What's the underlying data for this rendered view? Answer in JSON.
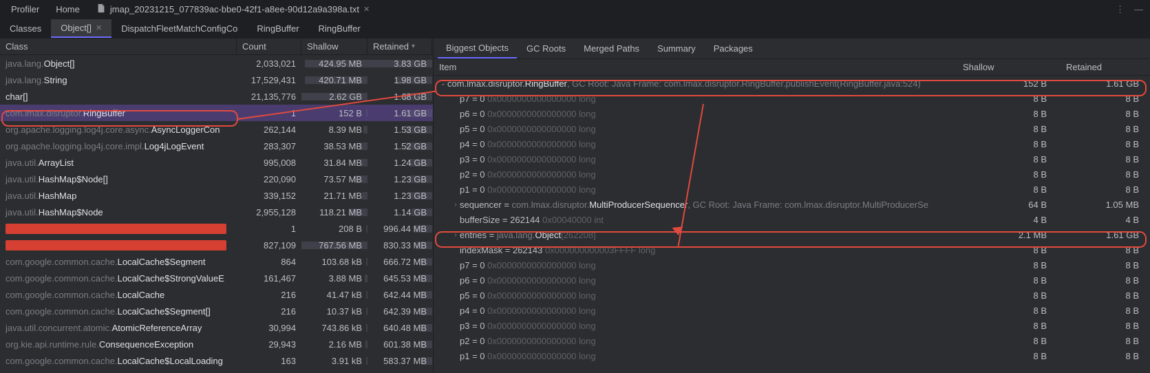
{
  "topTabs": {
    "profiler": "Profiler",
    "home": "Home",
    "filename": "jmap_20231215_077839ac-bbe0-42f1-a8ee-90d12a9a398a.txt"
  },
  "winControls": {
    "more": "⋮",
    "min": "—"
  },
  "subTabs": [
    {
      "label": "Classes",
      "close": false
    },
    {
      "label": "Object[]",
      "close": true,
      "active": true
    },
    {
      "label": "DispatchFleetMatchConfigCo",
      "close": false
    },
    {
      "label": "RingBuffer",
      "close": false
    },
    {
      "label": "RingBuffer",
      "close": false
    }
  ],
  "columns": {
    "class": "Class",
    "count": "Count",
    "shallow": "Shallow",
    "retained": "Retained"
  },
  "classRows": [
    {
      "pkg": "java.lang.",
      "cls": "Object[]",
      "count": "2,033,021",
      "shallow": "424.95 MB",
      "retained": "3.83 GB",
      "sb": 95,
      "rb": 100
    },
    {
      "pkg": "java.lang.",
      "cls": "String",
      "count": "17,529,431",
      "shallow": "420.71 MB",
      "retained": "1.98 GB",
      "sb": 95,
      "rb": 55
    },
    {
      "pkg": "",
      "cls": "char[]",
      "count": "21,135,776",
      "shallow": "2.62 GB",
      "retained": "1.68 GB",
      "sb": 100,
      "rb": 46
    },
    {
      "pkg": "com.lmax.disruptor.",
      "cls": "RingBuffer",
      "count": "1",
      "shallow": "152 B",
      "retained": "1.61 GB",
      "sb": 2,
      "rb": 44,
      "selected": true
    },
    {
      "pkg": "org.apache.logging.log4j.core.async.",
      "cls": "AsyncLoggerCon",
      "count": "262,144",
      "shallow": "8.39 MB",
      "retained": "1.53 GB",
      "sb": 6,
      "rb": 42
    },
    {
      "pkg": "org.apache.logging.log4j.core.impl.",
      "cls": "Log4jLogEvent",
      "count": "283,307",
      "shallow": "38.53 MB",
      "retained": "1.52 GB",
      "sb": 12,
      "rb": 42
    },
    {
      "pkg": "java.util.",
      "cls": "ArrayList",
      "count": "995,008",
      "shallow": "31.84 MB",
      "retained": "1.24 GB",
      "sb": 10,
      "rb": 35
    },
    {
      "pkg": "java.util.",
      "cls": "HashMap$Node[]",
      "count": "220,090",
      "shallow": "73.57 MB",
      "retained": "1.23 GB",
      "sb": 20,
      "rb": 35
    },
    {
      "pkg": "java.util.",
      "cls": "HashMap",
      "count": "339,152",
      "shallow": "21.71 MB",
      "retained": "1.23 GB",
      "sb": 8,
      "rb": 35
    },
    {
      "pkg": "java.util.",
      "cls": "HashMap$Node",
      "count": "2,955,128",
      "shallow": "118.21 MB",
      "retained": "1.14 GB",
      "sb": 28,
      "rb": 32
    },
    {
      "redacted": true,
      "count": "1",
      "shallow": "208 B",
      "retained": "996.44 MB",
      "sb": 2,
      "rb": 28,
      "rw": 98
    },
    {
      "redacted": true,
      "count": "827,109",
      "shallow": "767.56 MB",
      "retained": "830.33 MB",
      "sb": 100,
      "rb": 24,
      "rw": 98
    },
    {
      "pkg": "com.google.common.cache.",
      "cls": "LocalCache$Segment",
      "count": "864",
      "shallow": "103.68 kB",
      "retained": "666.72 MB",
      "sb": 2,
      "rb": 20
    },
    {
      "pkg": "com.google.common.cache.",
      "cls": "LocalCache$StrongValueE",
      "count": "161,467",
      "shallow": "3.88 MB",
      "retained": "645.53 MB",
      "sb": 4,
      "rb": 19
    },
    {
      "pkg": "com.google.common.cache.",
      "cls": "LocalCache",
      "count": "216",
      "shallow": "41.47 kB",
      "retained": "642.44 MB",
      "sb": 2,
      "rb": 19
    },
    {
      "pkg": "com.google.common.cache.",
      "cls": "LocalCache$Segment[]",
      "count": "216",
      "shallow": "10.37 kB",
      "retained": "642.39 MB",
      "sb": 2,
      "rb": 19
    },
    {
      "pkg": "java.util.concurrent.atomic.",
      "cls": "AtomicReferenceArray",
      "count": "30,994",
      "shallow": "743.86 kB",
      "retained": "640.48 MB",
      "sb": 2,
      "rb": 19
    },
    {
      "pkg": "org.kie.api.runtime.rule.",
      "cls": "ConsequenceException",
      "count": "29,943",
      "shallow": "2.16 MB",
      "retained": "601.38 MB",
      "sb": 3,
      "rb": 18
    },
    {
      "pkg": "com.google.common.cache.",
      "cls": "LocalCache$LocalLoading",
      "count": "163",
      "shallow": "3.91 kB",
      "retained": "583.37 MB",
      "sb": 2,
      "rb": 17
    }
  ],
  "rightTabs": [
    "Biggest Objects",
    "GC Roots",
    "Merged Paths",
    "Summary",
    "Packages"
  ],
  "rightTabActive": 0,
  "treeColumns": {
    "item": "Item",
    "shallow": "Shallow",
    "retained": "Retained"
  },
  "treeRows": [
    {
      "lvl": 0,
      "chev": "v",
      "pre": "com.lmax.disruptor.",
      "name": "RingBuffer",
      "suf": ", GC Root: Java Frame: com.lmax.disruptor.RingBuffer.publishEvent(RingBuffer.java:524)",
      "sh": "152 B",
      "rt": "1.61 GB"
    },
    {
      "lvl": 1,
      "pre": "p7 = 0 ",
      "hex": "0x0000000000000000  long",
      "sh": "8 B",
      "rt": "8 B"
    },
    {
      "lvl": 1,
      "pre": "p6 = 0 ",
      "hex": "0x0000000000000000  long",
      "sh": "8 B",
      "rt": "8 B"
    },
    {
      "lvl": 1,
      "pre": "p5 = 0 ",
      "hex": "0x0000000000000000  long",
      "sh": "8 B",
      "rt": "8 B"
    },
    {
      "lvl": 1,
      "pre": "p4 = 0 ",
      "hex": "0x0000000000000000  long",
      "sh": "8 B",
      "rt": "8 B"
    },
    {
      "lvl": 1,
      "pre": "p3 = 0 ",
      "hex": "0x0000000000000000  long",
      "sh": "8 B",
      "rt": "8 B"
    },
    {
      "lvl": 1,
      "pre": "p2 = 0 ",
      "hex": "0x0000000000000000  long",
      "sh": "8 B",
      "rt": "8 B"
    },
    {
      "lvl": 1,
      "pre": "p1 = 0 ",
      "hex": "0x0000000000000000  long",
      "sh": "8 B",
      "rt": "8 B"
    },
    {
      "lvl": 1,
      "chev": ">",
      "pre": "sequencer = ",
      "mid": "com.lmax.disruptor.",
      "name": "MultiProducerSequencer",
      "suf": ", GC Root: Java Frame: com.lmax.disruptor.MultiProducerSe",
      "sh": "64 B",
      "rt": "1.05 MB"
    },
    {
      "lvl": 1,
      "pre": "bufferSize = 262144 ",
      "hex": "0x00040000  int",
      "sh": "4 B",
      "rt": "4 B"
    },
    {
      "lvl": 1,
      "chev": ">",
      "pre": "entries = ",
      "mid": "java.lang.",
      "name": "Object",
      "idx": "[262208]",
      "sh": "2.1 MB",
      "rt": "1.61 GB",
      "selected": true
    },
    {
      "lvl": 1,
      "pre": "indexMask = 262143 ",
      "hex": "0x000000000003FFFF  long",
      "sh": "8 B",
      "rt": "8 B"
    },
    {
      "lvl": 1,
      "pre": "p7 = 0 ",
      "hex": "0x0000000000000000  long",
      "sh": "8 B",
      "rt": "8 B"
    },
    {
      "lvl": 1,
      "pre": "p6 = 0 ",
      "hex": "0x0000000000000000  long",
      "sh": "8 B",
      "rt": "8 B"
    },
    {
      "lvl": 1,
      "pre": "p5 = 0 ",
      "hex": "0x0000000000000000  long",
      "sh": "8 B",
      "rt": "8 B"
    },
    {
      "lvl": 1,
      "pre": "p4 = 0 ",
      "hex": "0x0000000000000000  long",
      "sh": "8 B",
      "rt": "8 B"
    },
    {
      "lvl": 1,
      "pre": "p3 = 0 ",
      "hex": "0x0000000000000000  long",
      "sh": "8 B",
      "rt": "8 B"
    },
    {
      "lvl": 1,
      "pre": "p2 = 0 ",
      "hex": "0x0000000000000000  long",
      "sh": "8 B",
      "rt": "8 B"
    },
    {
      "lvl": 1,
      "pre": "p1 = 0 ",
      "hex": "0x0000000000000000  long",
      "sh": "8 B",
      "rt": "8 B"
    }
  ]
}
